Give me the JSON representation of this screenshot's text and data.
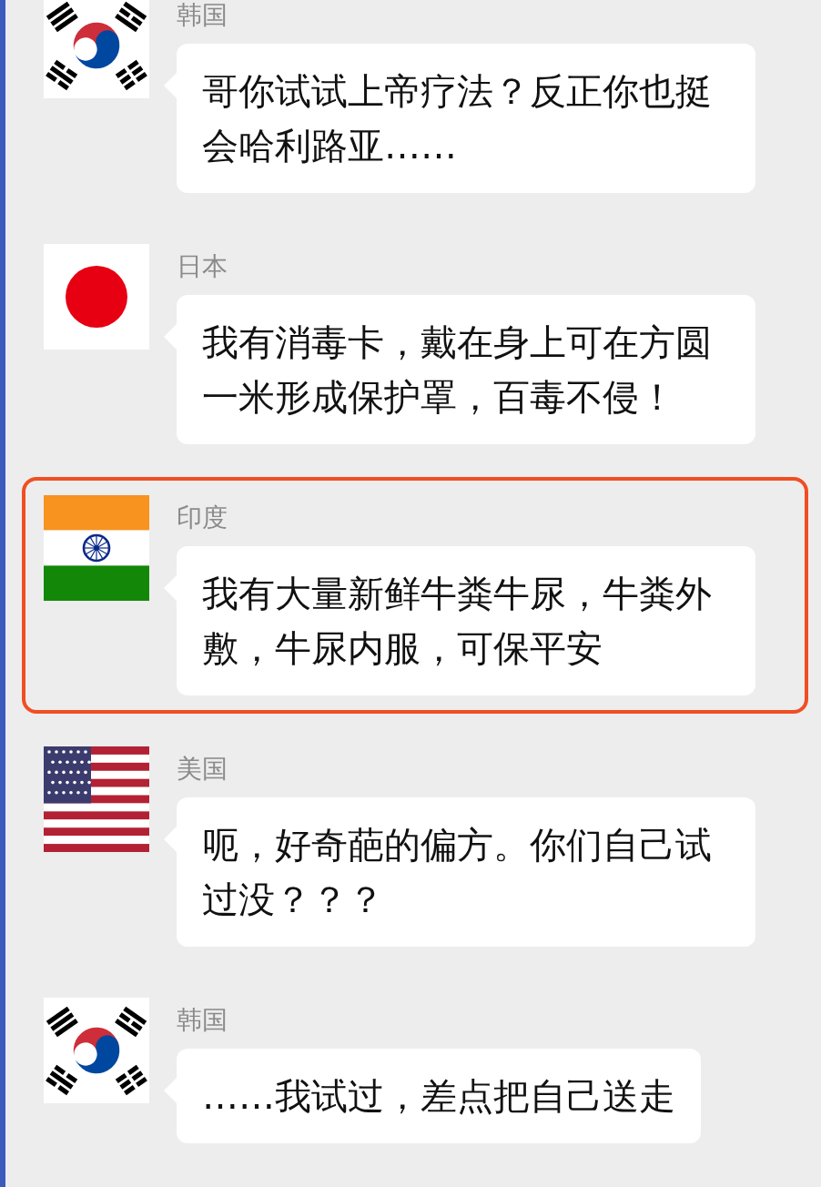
{
  "messages": [
    {
      "sender": "韩国",
      "kind": "korea",
      "highlighted": false,
      "text": "哥你试试上帝疗法？反正你也挺会哈利路亚……"
    },
    {
      "sender": "日本",
      "kind": "japan",
      "highlighted": false,
      "text": "我有消毒卡，戴在身上可在方圆一米形成保护罩，百毒不侵！"
    },
    {
      "sender": "印度",
      "kind": "india",
      "highlighted": true,
      "text": "我有大量新鲜牛粪牛尿，牛粪外敷，牛尿内服，可保平安"
    },
    {
      "sender": "美国",
      "kind": "usa",
      "highlighted": false,
      "text": "呃，好奇葩的偏方。你们自己试过没？？？"
    },
    {
      "sender": "韩国",
      "kind": "korea",
      "highlighted": false,
      "text": "……我试过，差点把自己送走"
    }
  ]
}
